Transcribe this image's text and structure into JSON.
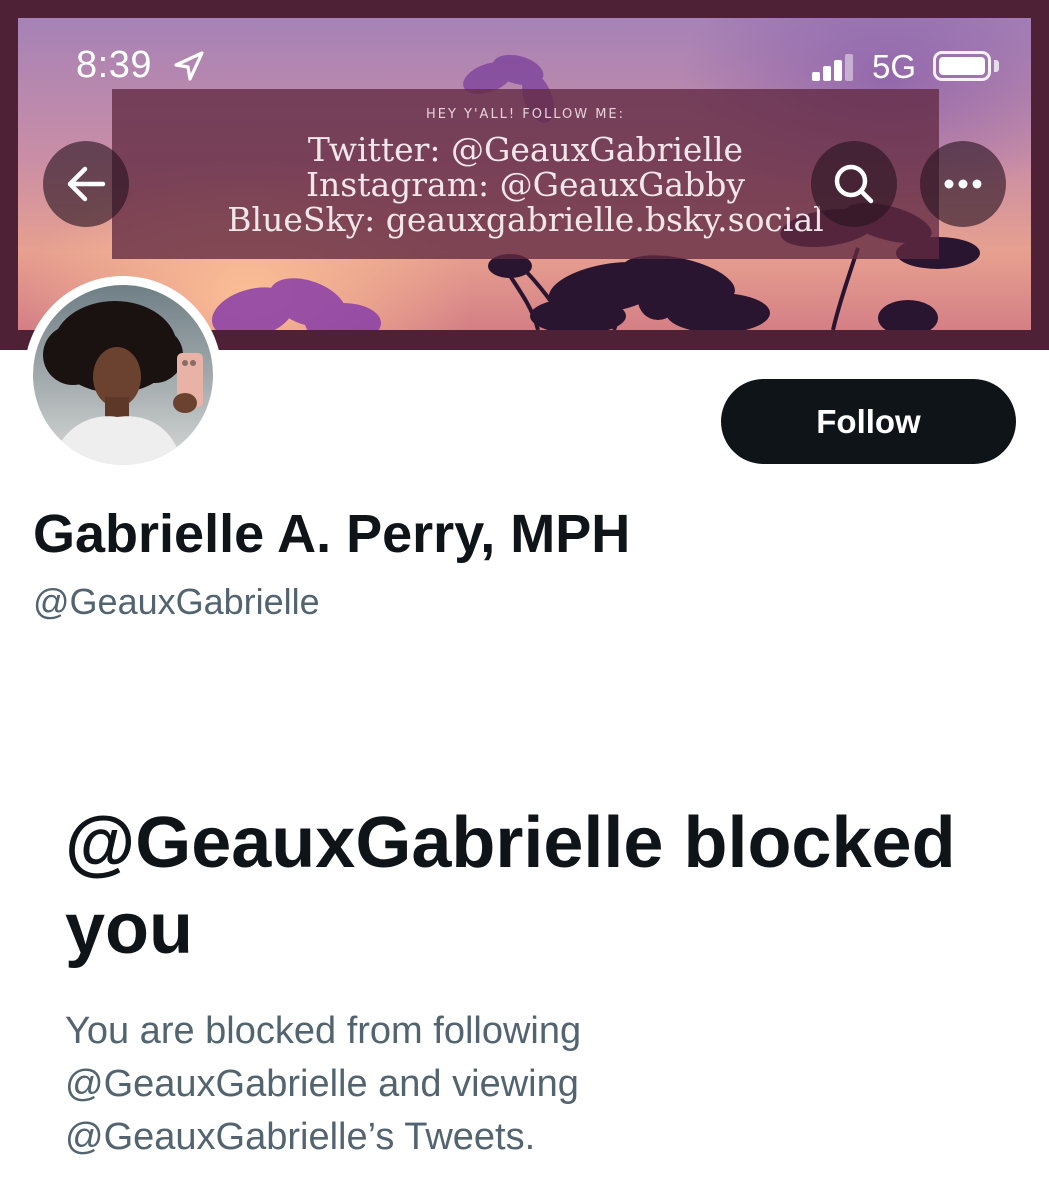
{
  "status_bar": {
    "time": "8:39",
    "network": "5G",
    "icons": [
      "location-arrow-icon",
      "cellular-signal-icon",
      "battery-icon"
    ]
  },
  "banner": {
    "heading": "HEY Y'ALL! FOLLOW ME:",
    "lines": [
      "Twitter: @GeauxGabrielle",
      "Instagram: @GeauxGabby",
      "BlueSky: geauxgabrielle.bsky.social"
    ]
  },
  "nav": {
    "back_icon": "back-arrow-icon",
    "search_icon": "search-icon",
    "more_icon": "more-options-icon"
  },
  "profile": {
    "display_name": "Gabrielle A. Perry, MPH",
    "handle": "@GeauxGabrielle",
    "follow_label": "Follow"
  },
  "blocked": {
    "title": "@GeauxGabrielle blocked you",
    "description": "You are blocked from following @GeauxGabrielle and viewing @GeauxGabrielle’s Tweets."
  },
  "colors": {
    "text_primary": "#0f1419",
    "text_secondary": "#536471",
    "follow_bg": "#0f1419",
    "banner_frame": "#4e2136",
    "banner_overlay": "#622a42"
  }
}
